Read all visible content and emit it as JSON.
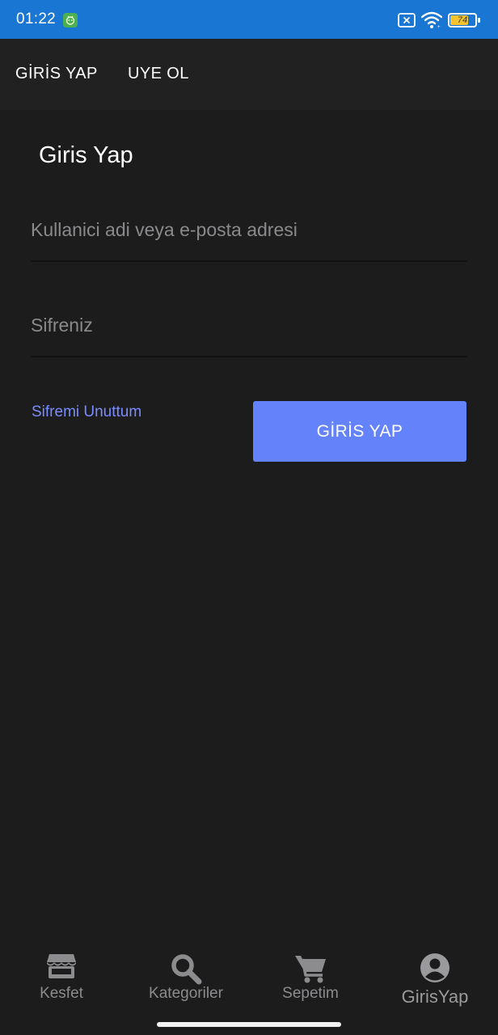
{
  "status_bar": {
    "time": "01:22",
    "battery_level": "74",
    "battery_fraction": 0.74,
    "background_color": "#1976d2",
    "icons": [
      "app-notification-icon",
      "close-notification-icon",
      "wifi-icon",
      "battery-icon"
    ]
  },
  "tabs": {
    "login": "GİRİS YAP",
    "signup": "UYE OL"
  },
  "form": {
    "title": "Giris Yap",
    "username_placeholder": "Kullanici adi veya e-posta adresi",
    "username_value": "",
    "password_placeholder": "Sifreniz",
    "password_value": "",
    "forgot_password": "Sifremi Unuttum",
    "submit_label": "GİRİS YAP",
    "accent_color": "#6482fa",
    "link_color": "#7b8cff"
  },
  "bottom_nav": {
    "items": [
      {
        "label": "Kesfet",
        "icon": "store-icon"
      },
      {
        "label": "Kategoriler",
        "icon": "search-icon"
      },
      {
        "label": "Sepetim",
        "icon": "cart-icon"
      },
      {
        "label": "GirisYap",
        "icon": "account-circle-icon"
      }
    ]
  }
}
